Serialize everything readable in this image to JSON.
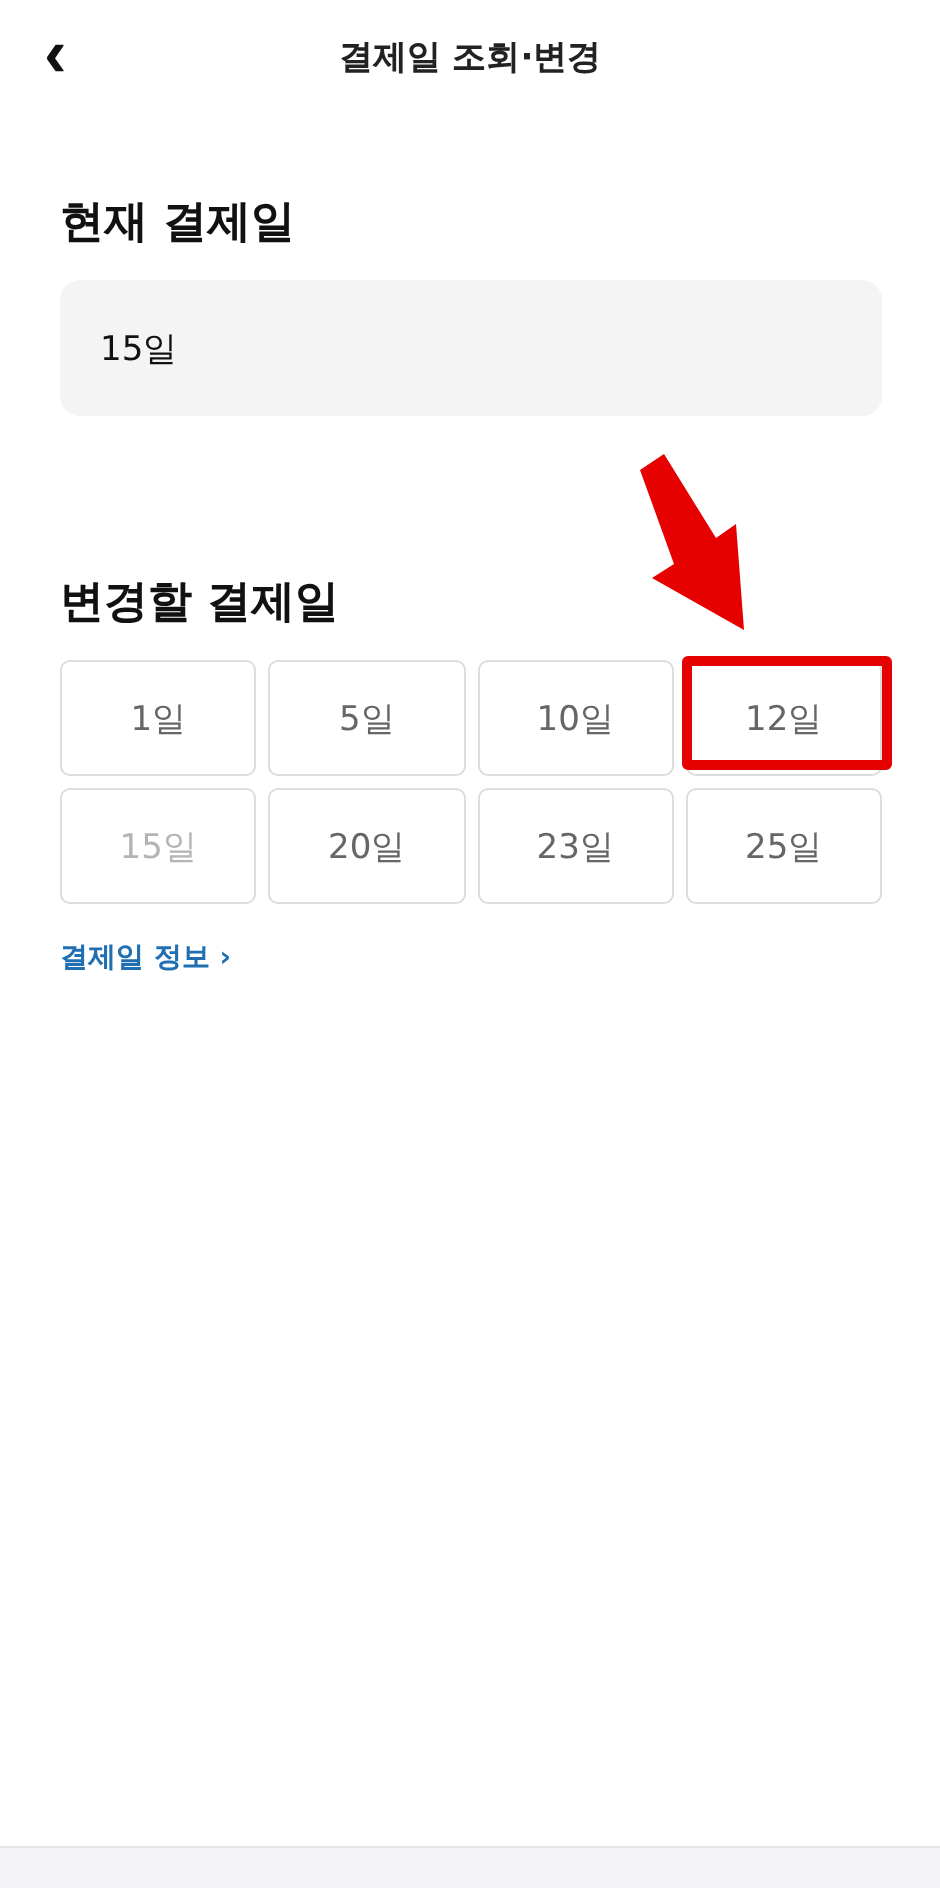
{
  "header": {
    "back_icon": "‹",
    "title": "결제일 조회·변경"
  },
  "current": {
    "heading": "현재 결제일",
    "value": "15일"
  },
  "change": {
    "heading": "변경할 결제일",
    "options": [
      {
        "label": "1일",
        "disabled": false,
        "highlighted": false
      },
      {
        "label": "5일",
        "disabled": false,
        "highlighted": false
      },
      {
        "label": "10일",
        "disabled": false,
        "highlighted": false
      },
      {
        "label": "12일",
        "disabled": false,
        "highlighted": true
      },
      {
        "label": "15일",
        "disabled": true,
        "highlighted": false
      },
      {
        "label": "20일",
        "disabled": false,
        "highlighted": false
      },
      {
        "label": "23일",
        "disabled": false,
        "highlighted": false
      },
      {
        "label": "25일",
        "disabled": false,
        "highlighted": false
      }
    ],
    "info_link": "결제일 정보 ›"
  }
}
